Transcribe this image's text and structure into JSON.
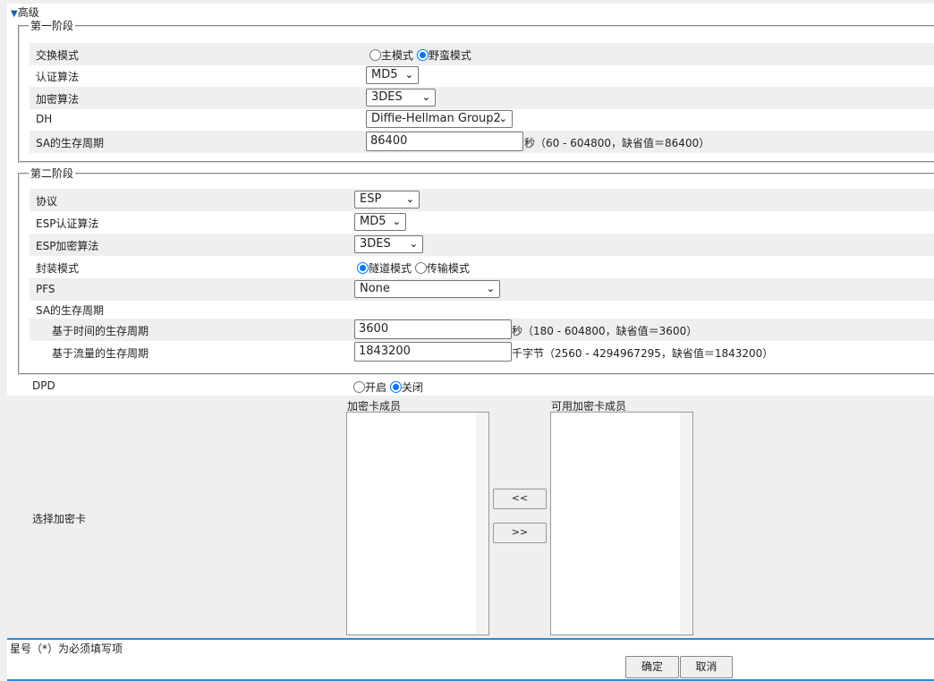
{
  "advanced": {
    "toggle_icon": "triangle-down-icon",
    "title": "高级"
  },
  "phase1": {
    "legend": "第一阶段",
    "exchange_mode": {
      "label": "交换模式",
      "options": [
        "主模式",
        "野蛮模式"
      ],
      "selected": "野蛮模式"
    },
    "auth": {
      "label": "认证算法",
      "value": "MD5"
    },
    "enc": {
      "label": "加密算法",
      "value": "3DES"
    },
    "dh": {
      "label": "DH",
      "value": "Diffie-Hellman Group2"
    },
    "sa": {
      "label": "SA的生存周期",
      "value": "86400",
      "hint": "秒（60 - 604800，缺省值＝86400）"
    }
  },
  "phase2": {
    "legend": "第二阶段",
    "protocol": {
      "label": "协议",
      "value": "ESP"
    },
    "esp_auth": {
      "label": "ESP认证算法",
      "value": "MD5"
    },
    "esp_enc": {
      "label": "ESP加密算法",
      "value": "3DES"
    },
    "encap": {
      "label": "封装模式",
      "options": [
        "隧道模式",
        "传输模式"
      ],
      "selected": "隧道模式"
    },
    "pfs": {
      "label": "PFS",
      "value": "None"
    },
    "sa_label": "SA的生存周期",
    "sa_time": {
      "label": "基于时间的生存周期",
      "value": "3600",
      "hint": "秒（180 - 604800，缺省值＝3600）"
    },
    "sa_traffic": {
      "label": "基于流量的生存周期",
      "value": "1843200",
      "hint": "千字节（2560 - 4294967295，缺省值＝1843200）"
    }
  },
  "dpd": {
    "label": "DPD",
    "options": [
      "开启",
      "关闭"
    ],
    "selected": "关闭"
  },
  "cards": {
    "label": "选择加密卡",
    "members_label": "加密卡成员",
    "available_label": "可用加密卡成员",
    "add_label": "<<",
    "remove_label": ">>"
  },
  "footer": {
    "note": "星号（*）为必须填写项",
    "ok": "确定",
    "cancel": "取消"
  },
  "colors": {
    "accent": "#0075ff",
    "row_gray": "#eeefee",
    "divider": "#2b8ad6"
  }
}
